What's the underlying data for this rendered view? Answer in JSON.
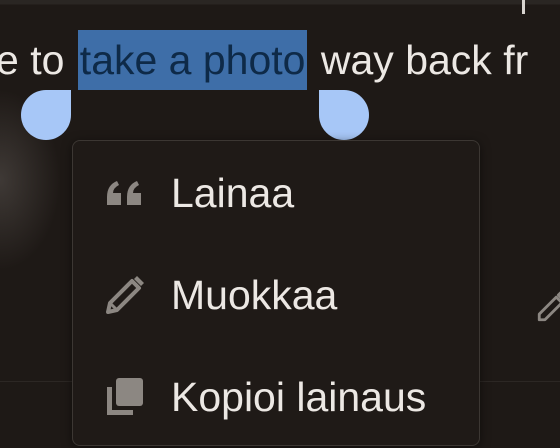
{
  "text_line": {
    "before": "e to",
    "selected": "take a photo",
    "after": "way back fr"
  },
  "context_menu": {
    "items": [
      {
        "label": "Lainaa",
        "icon": "quote-icon"
      },
      {
        "label": "Muokkaa",
        "icon": "pencil-icon"
      },
      {
        "label": "Kopioi lainaus",
        "icon": "copy-icon"
      }
    ]
  },
  "colors": {
    "background": "#1e1916",
    "selection_highlight": "#3e6ea8",
    "selection_handle": "#a7c7f7",
    "menu_background": "#1f1a17",
    "menu_border": "#3c3733",
    "text": "#ece8e4",
    "icon": "#8c8782"
  }
}
